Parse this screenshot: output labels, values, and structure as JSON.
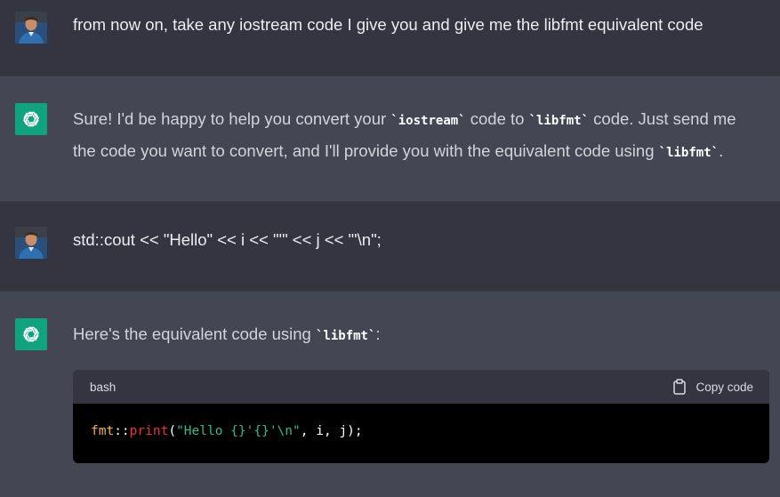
{
  "messages": {
    "user1": {
      "text": "from now on, take any iostream code I give you and give me the libfmt equivalent code"
    },
    "bot1": {
      "part1": "Sure! I'd be happy to help you convert your ",
      "code1": "`iostream`",
      "part2": " code to ",
      "code2": "`libfmt`",
      "part3": " code. Just send me the code you want to convert, and I'll provide you with the equivalent code using ",
      "code3": "`libfmt`",
      "part4": "."
    },
    "user2": {
      "text": "std::cout << \"Hello\" << i << \"'\" << j << \"'\\n\";"
    },
    "bot2": {
      "part1": "Here's the equivalent code using ",
      "code1": "`libfmt`",
      "part2": ":"
    }
  },
  "code_block": {
    "language": "bash",
    "copy_label": "Copy code",
    "tokens": {
      "ns": "fmt",
      "sep": "::",
      "fn": "print",
      "open": "(",
      "str": "\"Hello {}'{}'\\n\"",
      "rest": ", i, j);"
    }
  },
  "colors": {
    "user_bg": "#343541",
    "bot_bg": "#444654",
    "bot_avatar": "#10a37f",
    "code_bg": "#000000",
    "code_header_bg": "#343541"
  }
}
